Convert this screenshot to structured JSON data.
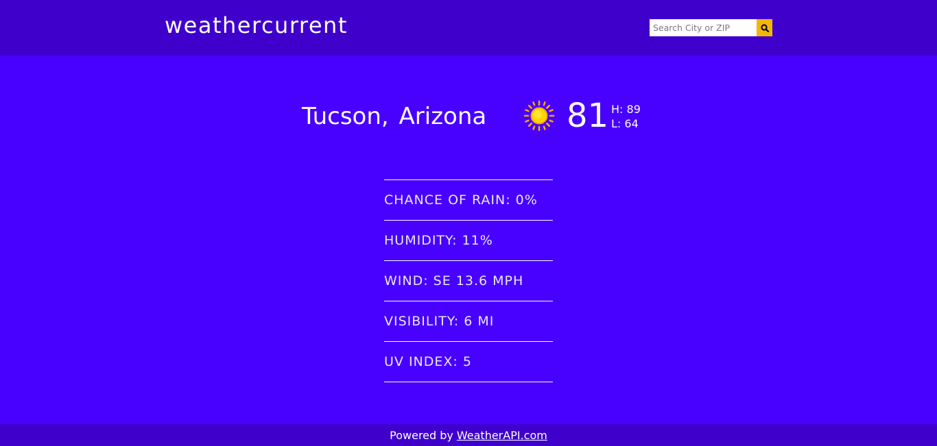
{
  "header": {
    "logo": "weathercurrent",
    "search": {
      "placeholder": "Search City or ZIP",
      "value": "",
      "button_icon": "search-icon"
    }
  },
  "current": {
    "location": "Tucson, Arizona",
    "condition_icon": "sun-icon",
    "temperature": "81",
    "high": "H: 89",
    "low": "L: 64"
  },
  "details": [
    "CHANCE OF RAIN: 0%",
    "HUMIDITY: 11%",
    "WIND: SE 13.6 MPH",
    "VISIBILITY: 6 MI",
    "UV INDEX: 5"
  ],
  "footer": {
    "prefix": "Powered by",
    "link": "WeatherAPI.com"
  },
  "colors": {
    "background": "#4800ff",
    "header_footer": "#3f00cc",
    "search_button": "#f2b705",
    "sun": "#ffd400"
  }
}
